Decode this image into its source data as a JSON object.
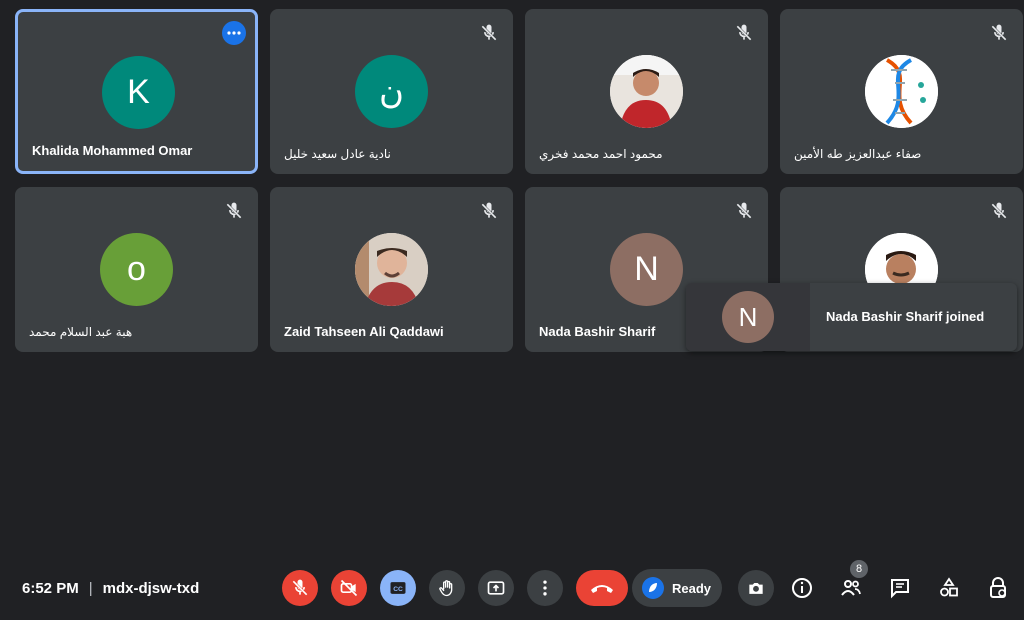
{
  "participants": [
    {
      "name": "Khalida Mohammed Omar",
      "initial": "K",
      "color": "#00897b"
    },
    {
      "name": "نادية عادل سعيد خليل",
      "initial": "ن",
      "color": "#00897b"
    },
    {
      "name": "محمود احمد محمد فخري",
      "photo": "man-red-shirt"
    },
    {
      "name": "صفاء عبدالعزيز طه الأمين",
      "photo": "dna-image"
    },
    {
      "name": "هبة عبد السلام محمد",
      "initial": "o",
      "color": "#689f38"
    },
    {
      "name": "Zaid Tahseen Ali Qaddawi",
      "photo": "young-man"
    },
    {
      "name": "Nada Bashir Sharif",
      "initial": "N",
      "color": "#8d6e63"
    },
    {
      "name": "",
      "photo": "man-white-bg"
    }
  ],
  "toast": {
    "initial": "N",
    "message": "Nada Bashir Sharif joined"
  },
  "footer": {
    "time": "6:52 PM",
    "separator": "|",
    "meeting_code": "mdx-djsw-txd"
  },
  "controls": {
    "ready_label": "Ready",
    "people_count": "8"
  },
  "colors": {
    "background": "#202124",
    "tile": "#3c4043",
    "active_border": "#8ab4f8",
    "danger": "#ea4335",
    "accent": "#1a73e8"
  }
}
